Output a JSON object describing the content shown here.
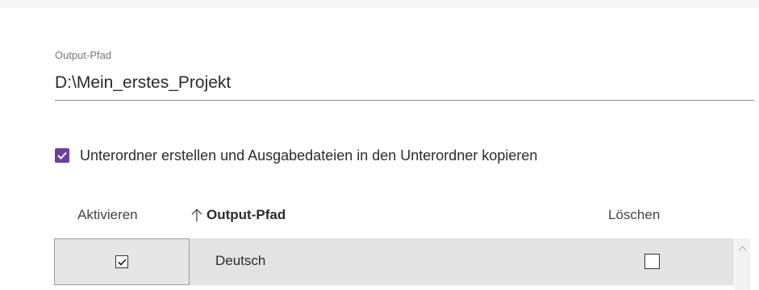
{
  "output_path": {
    "label": "Output-Pfad",
    "value": "D:\\Mein_erstes_Projekt"
  },
  "subfolder_option": {
    "label": "Unterordner erstellen und Ausgabedateien in den Unterordner kopieren",
    "checked": true,
    "accent_color": "#6b3fa0"
  },
  "table": {
    "columns": {
      "activate": "Aktivieren",
      "path": "Output-Pfad",
      "delete": "Löschen"
    },
    "sort_icon": "arrow-up-icon",
    "rows": [
      {
        "activated": true,
        "path": "Deutsch",
        "delete": false
      }
    ]
  }
}
